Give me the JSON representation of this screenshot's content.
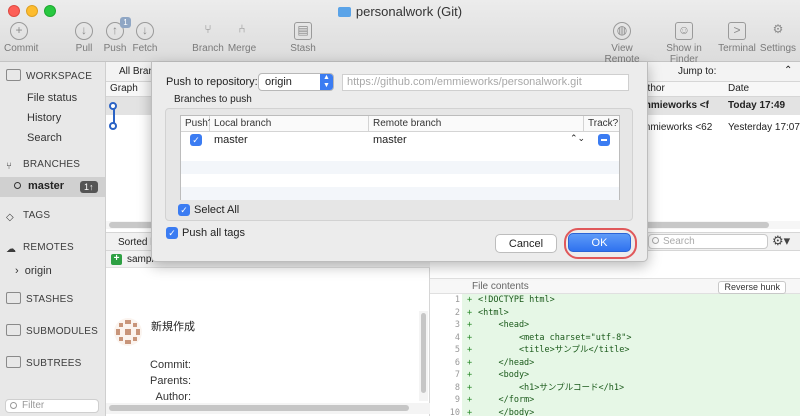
{
  "window": {
    "title": "personalwork (Git)"
  },
  "toolbar": {
    "commit": "Commit",
    "pull": "Pull",
    "push": "Push",
    "push_badge": "1",
    "fetch": "Fetch",
    "branch": "Branch",
    "merge": "Merge",
    "stash": "Stash",
    "view_remote": "View Remote",
    "show_in_finder": "Show in Finder",
    "terminal": "Terminal",
    "settings": "Settings"
  },
  "sidebar": {
    "workspace": "WORKSPACE",
    "file_status": "File status",
    "history": "History",
    "search": "Search",
    "branches": "BRANCHES",
    "master": "master",
    "master_badge": "1↑",
    "tags": "TAGS",
    "remotes": "REMOTES",
    "origin": "origin",
    "stashes": "STASHES",
    "submodules": "SUBMODULES",
    "subtrees": "SUBTREES",
    "filter_placeholder": "Filter"
  },
  "history": {
    "all_branches": "All Bran",
    "jump_to": "Jump to:",
    "col_graph": "Graph",
    "col_author": "uthor",
    "col_date": "Date",
    "rows": [
      {
        "author": "mmieworks <f",
        "date": "Today 17:49"
      },
      {
        "author": "mmieworks <62",
        "date": "Yesterday 17:07"
      }
    ]
  },
  "lower": {
    "sorted_by": "Sorted b",
    "search_placeholder": "Search",
    "file_name": "sampl",
    "commit_message": "新規作成",
    "commit_label": "Commit:",
    "parents_label": "Parents:",
    "author_label": "Author:"
  },
  "diff": {
    "header": "File contents",
    "reverse_hunk": "Reverse hunk",
    "lines": [
      {
        "num": "1",
        "code": "<!DOCTYPE html>"
      },
      {
        "num": "2",
        "code": "<html>"
      },
      {
        "num": "3",
        "code": "    <head>"
      },
      {
        "num": "4",
        "code": "        <meta charset=\"utf-8\">"
      },
      {
        "num": "5",
        "code": "        <title>サンプル</title>"
      },
      {
        "num": "6",
        "code": "    </head>"
      },
      {
        "num": "7",
        "code": "    <body>"
      },
      {
        "num": "8",
        "code": "        <h1>サンプルコード</h1>"
      },
      {
        "num": "9",
        "code": "    </form>"
      },
      {
        "num": "10",
        "code": "    </body>"
      }
    ]
  },
  "dialog": {
    "push_to_label": "Push to repository:",
    "remote": "origin",
    "url_placeholder": "https://github.com/emmieworks/personalwork.git",
    "branches_label": "Branches to push",
    "col_push": "Push?",
    "col_local": "Local branch",
    "col_remote": "Remote branch",
    "col_track": "Track?",
    "row_local": "master",
    "row_remote": "master",
    "select_all": "Select All",
    "push_all_tags": "Push all tags",
    "cancel": "Cancel",
    "ok": "OK"
  }
}
